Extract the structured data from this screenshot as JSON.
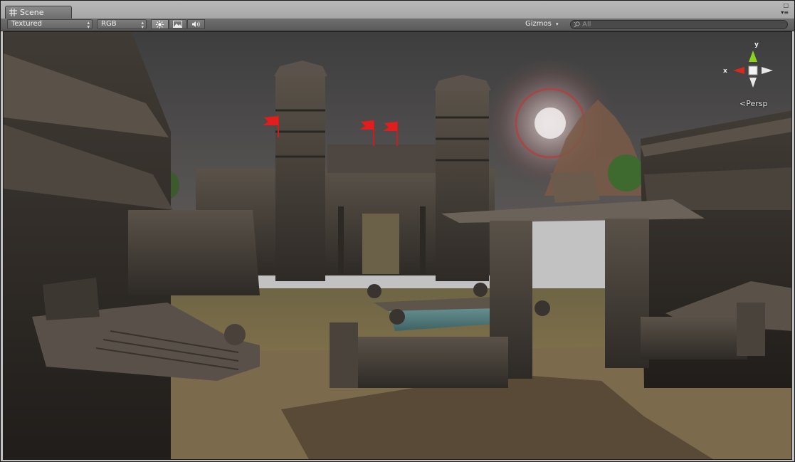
{
  "tab": {
    "label": "Scene",
    "icon": "scene-grid-icon"
  },
  "window_controls": {
    "maximize_icon": "maximize-icon",
    "menu_icon": "tab-menu-icon"
  },
  "toolbar": {
    "render_mode": "Textured",
    "channel_mode": "RGB",
    "lighting_icon": "sun-icon",
    "image_effects_icon": "image-icon",
    "audio_icon": "speaker-icon",
    "gizmos_label": "Gizmos",
    "search_placeholder": "All",
    "search_icon": "search-icon"
  },
  "orientation_gizmo": {
    "y_label": "y",
    "x_label": "x",
    "projection_label": "Persp",
    "colors": {
      "x": "#d62a1e",
      "y": "#8bd21e",
      "z": "#e8e8e8"
    }
  },
  "scene": {
    "flag_color": "#e11d1d",
    "sky_color": "#4a4a4a",
    "ground_color": "#7a6a48"
  }
}
